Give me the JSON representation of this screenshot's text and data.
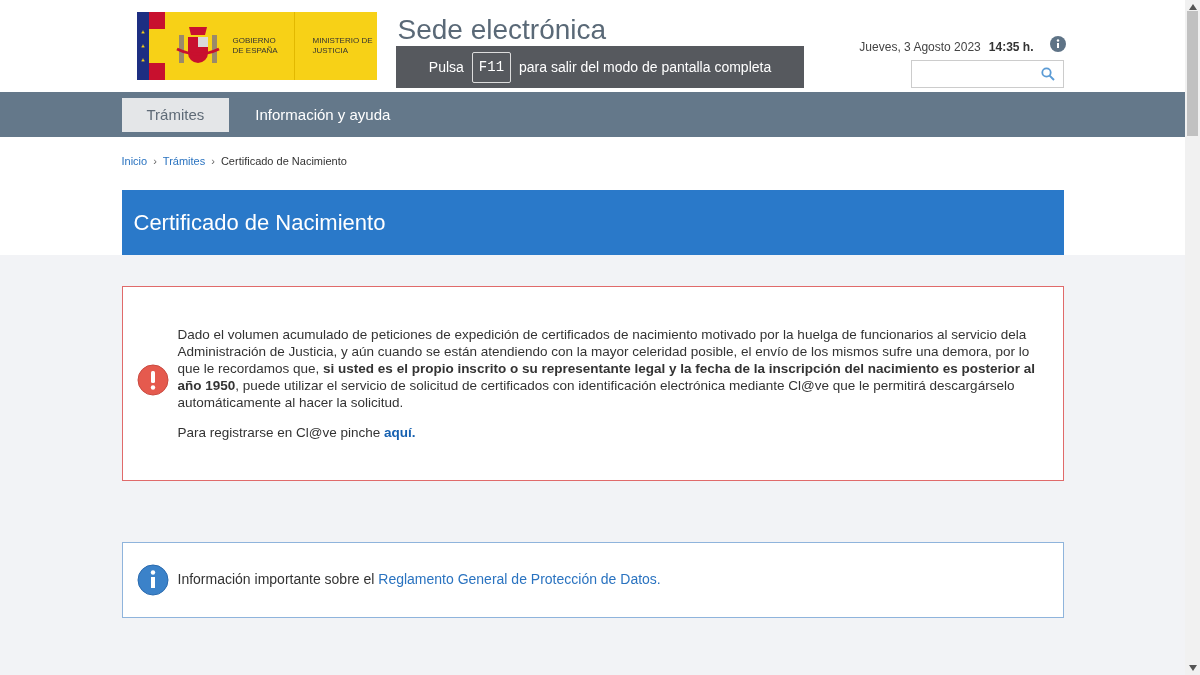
{
  "header": {
    "logo": {
      "government": "GOBIERNO DE ESPAÑA",
      "ministry": "MINISTERIO DE JUSTICIA"
    },
    "site_title": "Sede electrónica",
    "date": "Jueves, 3 Agosto 2023",
    "time": "14:35 h."
  },
  "fullscreen_notice": {
    "before": "Pulsa",
    "key": "F11",
    "after": "para salir del modo de pantalla completa"
  },
  "nav": [
    {
      "label": "Trámites",
      "selected": true
    },
    {
      "label": "Información y ayuda",
      "selected": false
    }
  ],
  "breadcrumb_separator": "›",
  "breadcrumb": [
    {
      "label": "Inicio",
      "kind": "link"
    },
    {
      "label": "Trámites",
      "kind": "link"
    },
    {
      "label": "Certificado de Nacimiento",
      "kind": "current"
    }
  ],
  "page_title": "Certificado de Nacimiento",
  "alert": {
    "text": "Dado el volumen acumulado de peticiones de expedición de certificados de nacimiento motivado por la huelga de funcionarios al servicio dela Administración de Justicia, y aún cuando se están atendiendo con la mayor celeridad posible, el envío de los mismos sufre una demora, por lo que le recordamos que, **si usted es el propio inscrito o su representante legal y la fecha de la inscripción del nacimiento es posterior al año 1950**, puede utilizar el servicio de solicitud de certificados con identificación electrónica mediante Cl@ve que le permitirá descargárselo automáticamente al hacer la solicitud.",
    "register_text": "Para registrarse en Cl@ve pinche",
    "register_link": "aquí."
  },
  "info": {
    "text": "Información importante sobre el",
    "link": "Reglamento General de Protección de Datos."
  }
}
